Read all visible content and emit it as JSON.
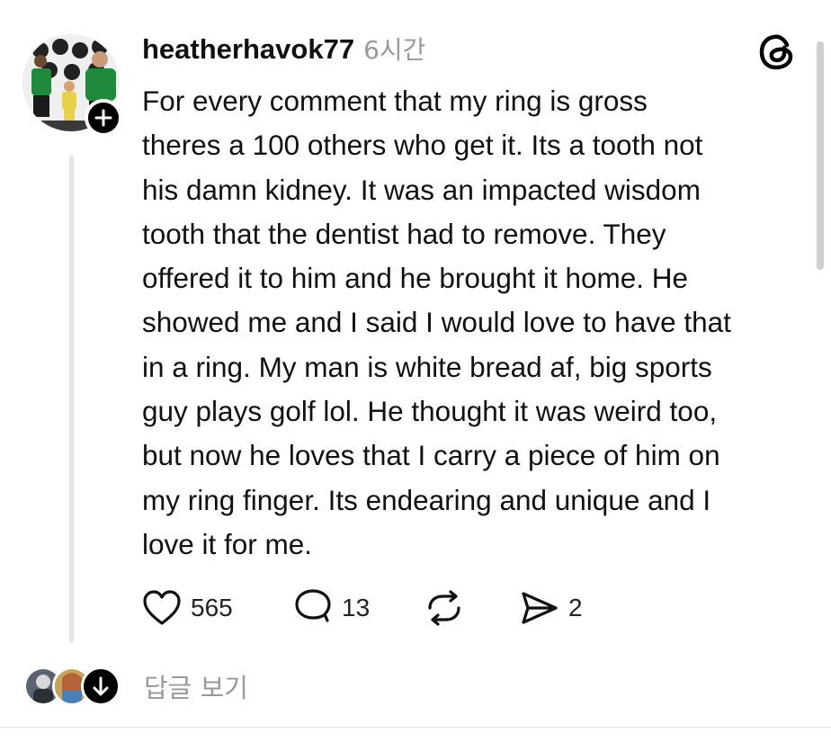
{
  "post": {
    "username": "heatherhavok77",
    "timestamp": "6시간",
    "body": "For every comment that my ring is gross\ntheres a 100 others who get it. Its a tooth not\nhis damn kidney. It was an impacted wisdom\ntooth that the dentist had to remove. They\noffered it to him and he brought it home. He\nshowed me and I said I would love to have that\nin a ring. My man is white bread af, big sports\nguy plays golf lol. He thought it was weird too,\nbut now he loves that I carry a piece of him on\nmy ring finger. Its endearing and unique and I\nlove it for me.",
    "likes": "565",
    "comments": "13",
    "shares": "2"
  },
  "replies": {
    "label": "답글 보기"
  },
  "icons": {
    "avatar_badge": "plus-icon",
    "app_logo": "threads-logo-icon",
    "like": "heart-icon",
    "comment": "comment-bubble-icon",
    "repost": "repost-icon",
    "share": "send-icon",
    "expand": "arrow-down-icon"
  },
  "colors": {
    "text": "#111111",
    "muted": "#9a9a9a",
    "thread_line": "#e6e6e6"
  }
}
